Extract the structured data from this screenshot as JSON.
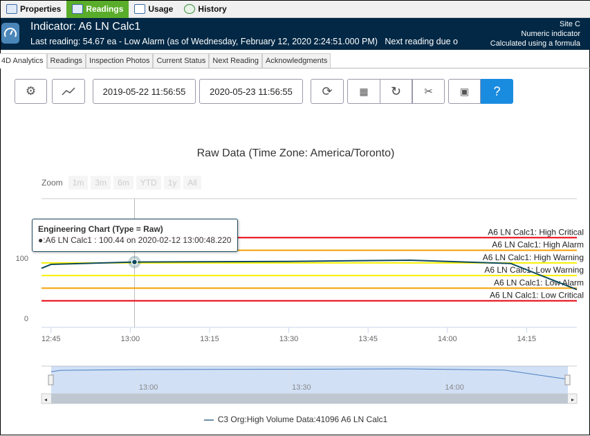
{
  "top_tabs": [
    {
      "label": "Properties"
    },
    {
      "label": "Readings"
    },
    {
      "label": "Usage"
    },
    {
      "label": "History"
    }
  ],
  "header": {
    "title": "Indicator: A6 LN Calc1",
    "last_reading": "Last reading: 54.67 ea - Low Alarm (as of Wednesday, February 12, 2020 2:24:51.000 PM)   Next reading due o",
    "site": "Site C",
    "type": "Numeric indicator",
    "calc": "Calculated using a formula"
  },
  "sub_tabs": [
    {
      "label": "4D Analytics"
    },
    {
      "label": "Readings"
    },
    {
      "label": "Inspection Photos"
    },
    {
      "label": "Current Status"
    },
    {
      "label": "Next Reading"
    },
    {
      "label": "Acknowledgments"
    }
  ],
  "toolbar": {
    "start_date": "2019-05-22 11:56:55",
    "end_date": "2020-05-23 11:56:55",
    "help": "?"
  },
  "zoom": {
    "label": "Zoom",
    "options": [
      "1m",
      "3m",
      "6m",
      "YTD",
      "1y",
      "All"
    ]
  },
  "tooltip": {
    "title": "Engineering Chart (Type = Raw)",
    "text": "●:A6 LN Calc1 : 100.44 on 2020-02-12 13:00:48.220"
  },
  "chart_data": {
    "type": "line",
    "title": "Raw Data (Time Zone: America/Toronto)",
    "x_unit": "minutes after 12:00",
    "xlim": [
      43.2,
      144.5
    ],
    "ylim": [
      0,
      100
    ],
    "y_ticks": [
      {
        "v": 0,
        "label": "0"
      },
      {
        "v": 100,
        "label": "100"
      }
    ],
    "x_ticks": [
      {
        "v": 45,
        "label": "12:45"
      },
      {
        "v": 60,
        "label": "13:00"
      },
      {
        "v": 75,
        "label": "13:15"
      },
      {
        "v": 90,
        "label": "13:30"
      },
      {
        "v": 105,
        "label": "13:45"
      },
      {
        "v": 120,
        "label": "14:00"
      },
      {
        "v": 135,
        "label": "14:15"
      }
    ],
    "series": [
      {
        "name": "C3 Org:High Volume Data:41096 A6 LN Calc1",
        "color": "#0d4a5e",
        "points": [
          [
            43.2,
            90
          ],
          [
            45,
            96.5
          ],
          [
            60.8,
            100.44
          ],
          [
            90,
            101.5
          ],
          [
            113,
            103.5
          ],
          [
            132,
            98
          ],
          [
            144.5,
            54.67
          ]
        ]
      }
    ],
    "thresholds": [
      {
        "label": "A6 LN Calc1: High Critical",
        "value": 141,
        "color": "#e8000b"
      },
      {
        "label": "A6 LN Calc1: High Alarm",
        "value": 120,
        "color": "#f5a000"
      },
      {
        "label": "A6 LN Calc1: High Warning",
        "value": 99,
        "color": "#f7f000"
      },
      {
        "label": "A6 LN Calc1: Low Warning",
        "value": 78,
        "color": "#f7f000"
      },
      {
        "label": "A6 LN Calc1: Low Alarm",
        "value": 57,
        "color": "#f5a000"
      },
      {
        "label": "A6 LN Calc1: Low Critical",
        "value": 36,
        "color": "#e8000b"
      }
    ],
    "highlight": {
      "x": 60.8,
      "y": 100.44
    },
    "navigator_ticks": [
      {
        "v": 60,
        "label": "13:00"
      },
      {
        "v": 90,
        "label": "13:30"
      },
      {
        "v": 120,
        "label": "14:00"
      }
    ]
  }
}
